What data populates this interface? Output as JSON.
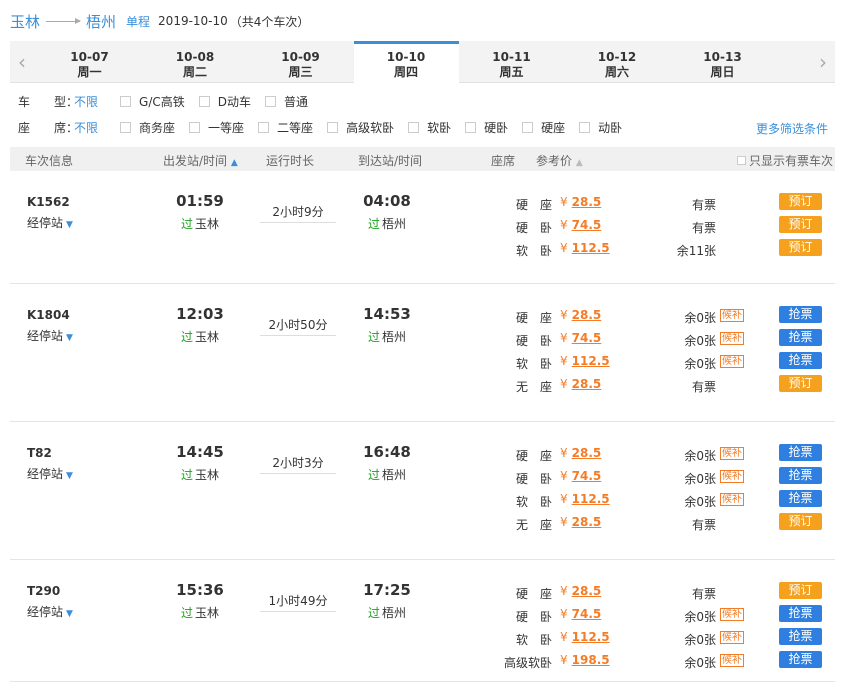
{
  "route": {
    "from": "玉林",
    "to": "梧州",
    "trip_type": "单程",
    "date": "2019-10-10",
    "count_text": "（共4个车次）"
  },
  "dates": [
    {
      "date": "10-07",
      "weekday": "周一"
    },
    {
      "date": "10-08",
      "weekday": "周二"
    },
    {
      "date": "10-09",
      "weekday": "周三"
    },
    {
      "date": "10-10",
      "weekday": "周四",
      "active": true
    },
    {
      "date": "10-11",
      "weekday": "周五"
    },
    {
      "date": "10-12",
      "weekday": "周六"
    },
    {
      "date": "10-13",
      "weekday": "周日"
    }
  ],
  "filters": {
    "type_label": "车　　型：",
    "type_all": "不限",
    "type_options": [
      "G/C高铁",
      "D动车",
      "普通"
    ],
    "seat_label": "座　　席：",
    "seat_all": "不限",
    "seat_options": [
      "商务座",
      "一等座",
      "二等座",
      "高级软卧",
      "软卧",
      "硬卧",
      "硬座",
      "动卧"
    ],
    "more": "更多筛选条件"
  },
  "table_header": {
    "train": "车次信息",
    "depart": "出发站/时间",
    "duration": "运行时长",
    "arrive": "到达站/时间",
    "seat": "座席",
    "price": "参考价",
    "only_available": "只显示有票车次"
  },
  "trains": [
    {
      "no": "K1562",
      "stops": "经停站",
      "dep_time": "01:59",
      "pass": "过",
      "dep_station": "玉林",
      "duration": "2小时9分",
      "arr_time": "04:08",
      "arr_station": "梧州",
      "seats": [
        {
          "name": "硬　座",
          "yen": "¥",
          "price": "28.5",
          "tickets": "有票",
          "waitlist": "",
          "btn": "预订",
          "kind": "book"
        },
        {
          "name": "硬　卧",
          "yen": "¥",
          "price": "74.5",
          "tickets": "有票",
          "waitlist": "",
          "btn": "预订",
          "kind": "book"
        },
        {
          "name": "软　卧",
          "yen": "¥",
          "price": "112.5",
          "tickets": "余11张",
          "waitlist": "",
          "btn": "预订",
          "kind": "book"
        }
      ]
    },
    {
      "no": "K1804",
      "stops": "经停站",
      "dep_time": "12:03",
      "pass": "过",
      "dep_station": "玉林",
      "duration": "2小时50分",
      "arr_time": "14:53",
      "arr_station": "梧州",
      "seats": [
        {
          "name": "硬　座",
          "yen": "¥",
          "price": "28.5",
          "tickets": "余0张",
          "waitlist": "候补",
          "btn": "抢票",
          "kind": "grab"
        },
        {
          "name": "硬　卧",
          "yen": "¥",
          "price": "74.5",
          "tickets": "余0张",
          "waitlist": "候补",
          "btn": "抢票",
          "kind": "grab"
        },
        {
          "name": "软　卧",
          "yen": "¥",
          "price": "112.5",
          "tickets": "余0张",
          "waitlist": "候补",
          "btn": "抢票",
          "kind": "grab"
        },
        {
          "name": "无　座",
          "yen": "¥",
          "price": "28.5",
          "tickets": "有票",
          "waitlist": "",
          "btn": "预订",
          "kind": "book"
        }
      ]
    },
    {
      "no": "T82",
      "stops": "经停站",
      "dep_time": "14:45",
      "pass": "过",
      "dep_station": "玉林",
      "duration": "2小时3分",
      "arr_time": "16:48",
      "arr_station": "梧州",
      "seats": [
        {
          "name": "硬　座",
          "yen": "¥",
          "price": "28.5",
          "tickets": "余0张",
          "waitlist": "候补",
          "btn": "抢票",
          "kind": "grab"
        },
        {
          "name": "硬　卧",
          "yen": "¥",
          "price": "74.5",
          "tickets": "余0张",
          "waitlist": "候补",
          "btn": "抢票",
          "kind": "grab"
        },
        {
          "name": "软　卧",
          "yen": "¥",
          "price": "112.5",
          "tickets": "余0张",
          "waitlist": "候补",
          "btn": "抢票",
          "kind": "grab"
        },
        {
          "name": "无　座",
          "yen": "¥",
          "price": "28.5",
          "tickets": "有票",
          "waitlist": "",
          "btn": "预订",
          "kind": "book"
        }
      ]
    },
    {
      "no": "T290",
      "stops": "经停站",
      "dep_time": "15:36",
      "pass": "过",
      "dep_station": "玉林",
      "duration": "1小时49分",
      "arr_time": "17:25",
      "arr_station": "梧州",
      "seats": [
        {
          "name": "硬　座",
          "yen": "¥",
          "price": "28.5",
          "tickets": "有票",
          "waitlist": "",
          "btn": "预订",
          "kind": "book"
        },
        {
          "name": "硬　卧",
          "yen": "¥",
          "price": "74.5",
          "tickets": "余0张",
          "waitlist": "候补",
          "btn": "抢票",
          "kind": "grab"
        },
        {
          "name": "软　卧",
          "yen": "¥",
          "price": "112.5",
          "tickets": "余0张",
          "waitlist": "候补",
          "btn": "抢票",
          "kind": "grab"
        },
        {
          "name": "高级软卧",
          "yen": "¥",
          "price": "198.5",
          "tickets": "余0张",
          "waitlist": "候补",
          "btn": "抢票",
          "kind": "grab"
        }
      ]
    }
  ],
  "colors": {
    "accent": "#3a8fd8",
    "price": "#f47c26",
    "book": "#f6a11d",
    "grab": "#2e7fe0",
    "pass": "#1fa01f"
  }
}
